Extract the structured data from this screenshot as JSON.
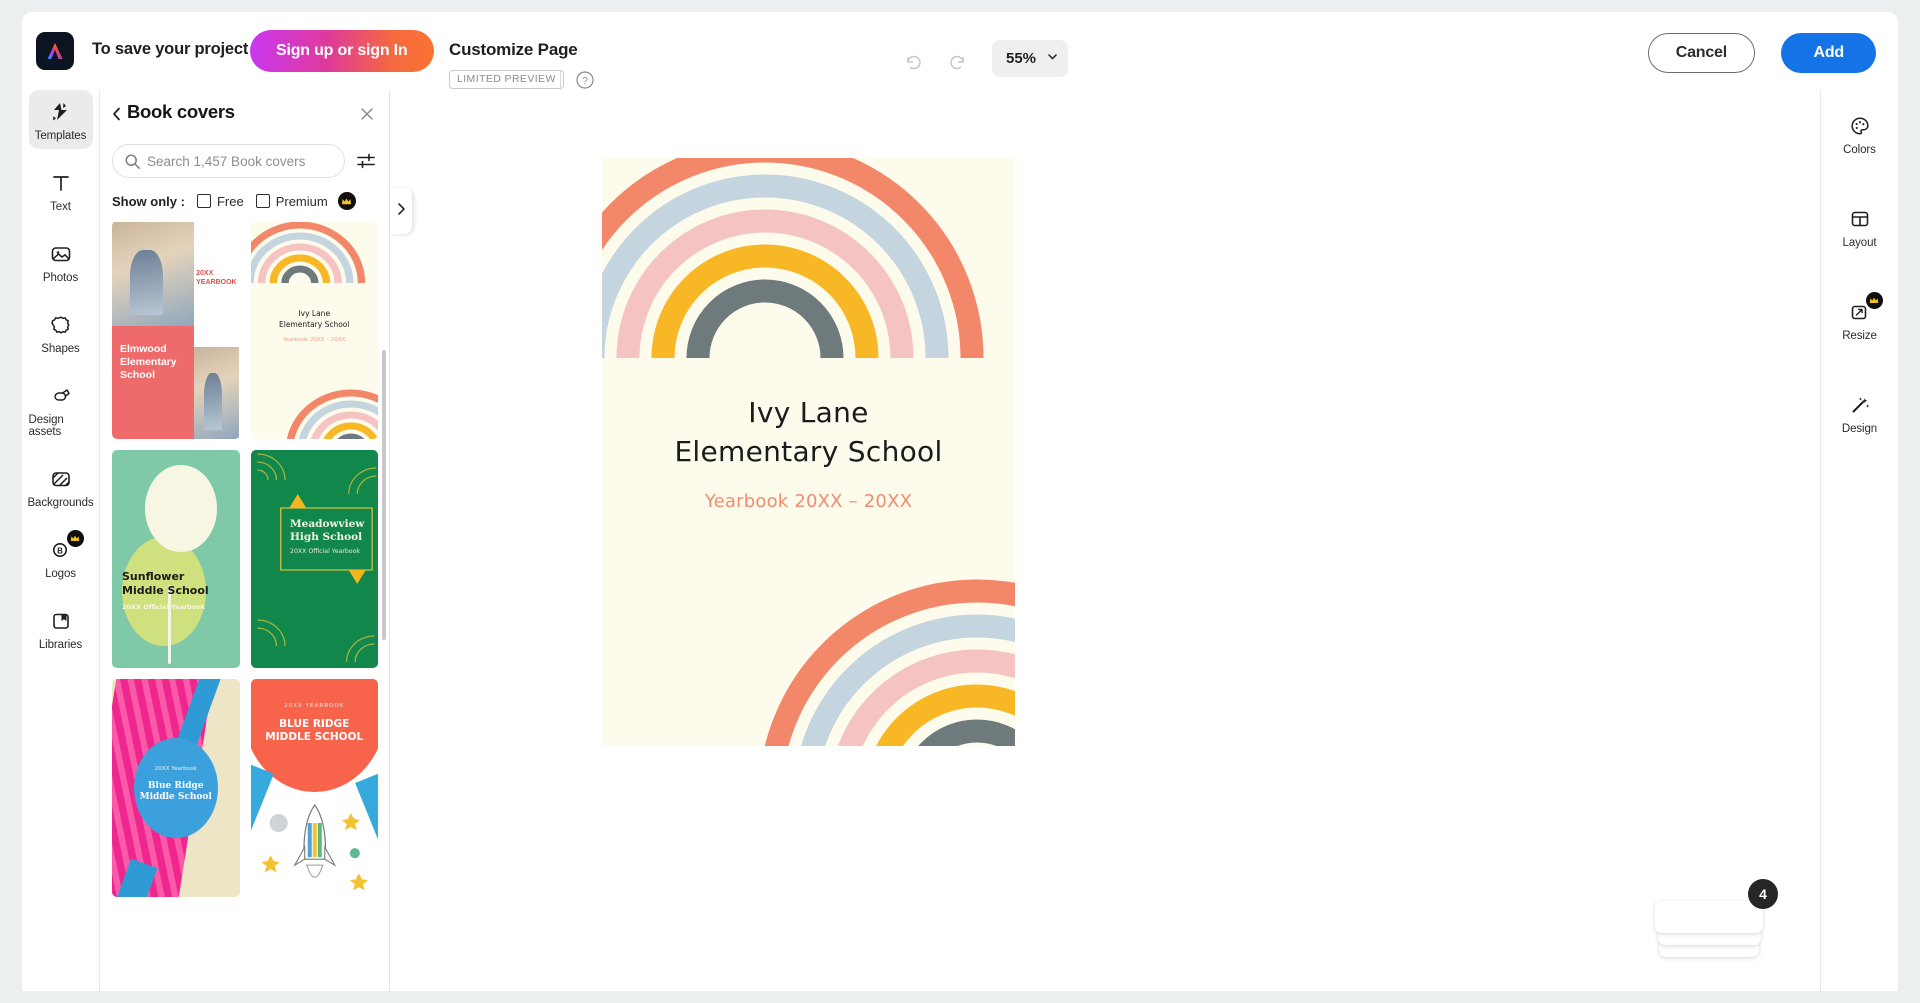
{
  "app": {
    "logo": "adobe-express-logo",
    "save_prompt": "To save your project",
    "signup_label": "Sign up or sign In",
    "doc_title": "Customize Page",
    "preview_badge": "LIMITED PREVIEW",
    "help_icon": "help-circle-icon",
    "undo_icon": "undo-icon",
    "redo_icon": "redo-icon",
    "zoom_level": "55%",
    "zoom_chevron": "chevron-down-icon",
    "cancel_label": "Cancel",
    "add_label": "Add"
  },
  "left_rail": {
    "items": [
      {
        "label": "Templates",
        "icon": "templates-icon",
        "active": true,
        "premium": false
      },
      {
        "label": "Text",
        "icon": "text-icon",
        "active": false,
        "premium": false
      },
      {
        "label": "Photos",
        "icon": "photos-icon",
        "active": false,
        "premium": false
      },
      {
        "label": "Shapes",
        "icon": "shapes-icon",
        "active": false,
        "premium": false
      },
      {
        "label": "Design assets",
        "icon": "design-assets-icon",
        "active": false,
        "premium": false
      },
      {
        "label": "Backgrounds",
        "icon": "backgrounds-icon",
        "active": false,
        "premium": false
      },
      {
        "label": "Logos",
        "icon": "logos-icon",
        "active": false,
        "premium": true
      },
      {
        "label": "Libraries",
        "icon": "libraries-icon",
        "active": false,
        "premium": false
      }
    ]
  },
  "panel": {
    "back_icon": "back-chevron-icon",
    "title": "Book covers",
    "close_icon": "close-icon",
    "search": {
      "icon": "search-icon",
      "placeholder": "Search 1,457 Book covers ...",
      "value": "",
      "filter_icon": "filter-sliders-icon"
    },
    "show_only": {
      "label": "Show only :",
      "options": [
        {
          "label": "Free",
          "checked": false,
          "premium": false
        },
        {
          "label": "Premium",
          "checked": false,
          "premium": true
        }
      ]
    },
    "collapse_icon": "chevron-right-icon",
    "templates": [
      {
        "id": "strip-pencils",
        "kind": "partial-light"
      },
      {
        "id": "strip-dark",
        "kind": "partial-dark"
      },
      {
        "id": "elmwood-elementary",
        "kind": "elmwood",
        "lines": [
          "Elmwood",
          "Elementary",
          "School"
        ],
        "side_label": "20XX\nYEARBOOK"
      },
      {
        "id": "ivy-lane-elementary",
        "kind": "ivylane",
        "title_lines": [
          "Ivy Lane",
          "Elementary School"
        ],
        "subtitle": "Yearbook 20XX – 20XX"
      },
      {
        "id": "sunflower-middle",
        "kind": "sunflower",
        "title_lines": [
          "Sunflower",
          "Middle School"
        ],
        "subtitle": "20XX Official Yearbook"
      },
      {
        "id": "meadowview-high",
        "kind": "meadowview",
        "title_lines": [
          "Meadowview",
          "High School"
        ],
        "subtitle": "20XX Official Yearbook"
      },
      {
        "id": "blue-ridge-circle",
        "kind": "blueridge-circle",
        "eyebrow": "20XX Yearbook",
        "title_lines": [
          "Blue Ridge",
          "Middle School"
        ]
      },
      {
        "id": "blue-ridge-rocket",
        "kind": "blueridge-rocket",
        "eyebrow": "20XX YEARBOOK",
        "title_lines": [
          "BLUE RIDGE",
          "MIDDLE SCHOOL"
        ]
      }
    ]
  },
  "canvas": {
    "document": {
      "title_line_1": "Ivy Lane",
      "title_line_2": "Elementary School",
      "subtitle": "Yearbook 20XX – 20XX",
      "background_color": "#fdfbec",
      "subtitle_color": "#f08c72",
      "rainbow_colors": [
        "#f2876a",
        "#c4d5e0",
        "#f5c3c2",
        "#f8b724",
        "#6f7a7c"
      ]
    },
    "page_stack": {
      "badge_count": "4"
    }
  },
  "right_rail": {
    "items": [
      {
        "label": "Colors",
        "icon": "colors-palette-icon",
        "premium": false
      },
      {
        "label": "Layout",
        "icon": "layout-icon",
        "premium": false
      },
      {
        "label": "Resize",
        "icon": "resize-icon",
        "premium": true
      },
      {
        "label": "Design",
        "icon": "design-wand-icon",
        "premium": false
      }
    ]
  }
}
